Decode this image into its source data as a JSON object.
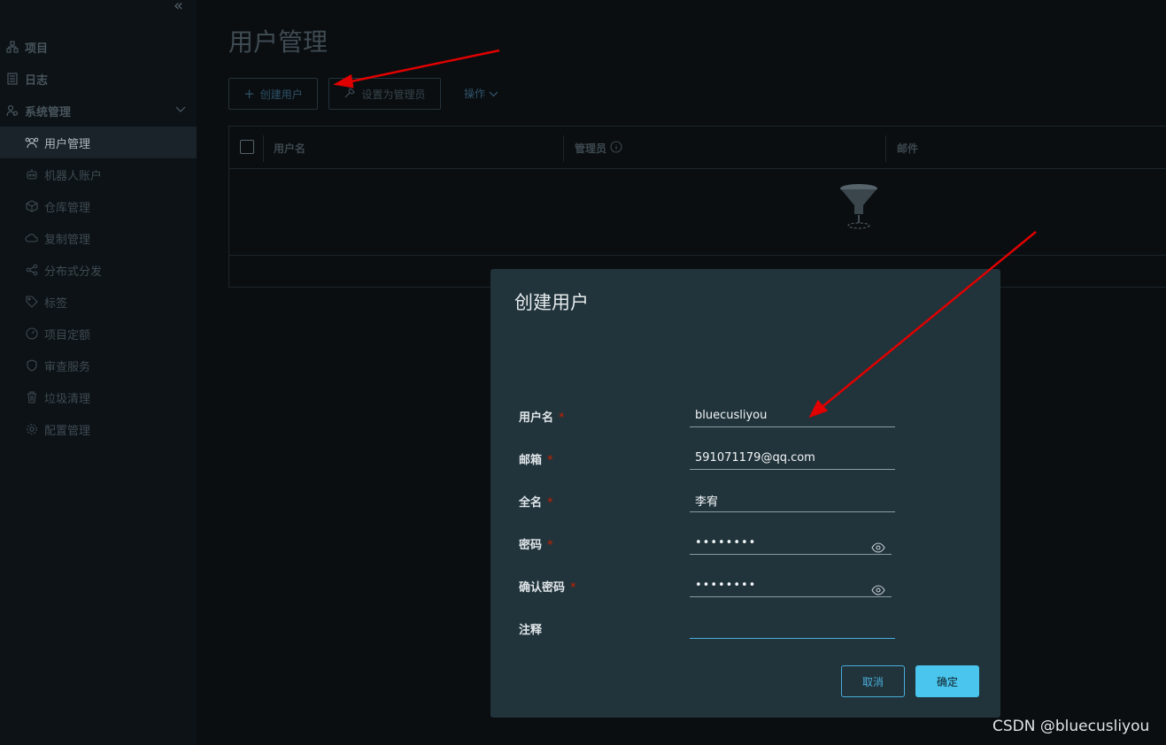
{
  "sidebar": {
    "collapse_glyph": "«",
    "items": [
      {
        "label": "项目",
        "icon": "project-icon"
      },
      {
        "label": "日志",
        "icon": "log-icon"
      },
      {
        "label": "系统管理",
        "icon": "system-admin-icon"
      },
      {
        "label": "用户管理",
        "icon": "users-icon"
      },
      {
        "label": "机器人账户",
        "icon": "robot-icon"
      },
      {
        "label": "仓库管理",
        "icon": "cube-icon"
      },
      {
        "label": "复制管理",
        "icon": "cloud-icon"
      },
      {
        "label": "分布式分发",
        "icon": "share-icon"
      },
      {
        "label": "标签",
        "icon": "tag-icon"
      },
      {
        "label": "项目定额",
        "icon": "dashboard-icon"
      },
      {
        "label": "审查服务",
        "icon": "shield-icon"
      },
      {
        "label": "垃圾清理",
        "icon": "trash-icon"
      },
      {
        "label": "配置管理",
        "icon": "gear-icon"
      }
    ]
  },
  "main": {
    "title": "用户管理",
    "toolbar": {
      "create_user": "创建用户",
      "set_admin": "设置为管理员",
      "actions": "操作"
    },
    "table": {
      "columns": [
        "用户名",
        "管理员",
        "邮件"
      ]
    }
  },
  "dialog": {
    "title": "创建用户",
    "fields": [
      {
        "label": "用户名",
        "value": "bluecusliyou",
        "required": "*"
      },
      {
        "label": "邮箱",
        "value": "591071179@qq.com",
        "required": "*"
      },
      {
        "label": "全名",
        "value": "李宥",
        "required": "*"
      },
      {
        "label": "密码",
        "value": "••••••••",
        "required": "*"
      },
      {
        "label": "确认密码",
        "value": "••••••••",
        "required": "*"
      },
      {
        "label": "注释",
        "value": ""
      }
    ],
    "cancel": "取消",
    "confirm": "确定"
  },
  "watermark": "CSDN @bluecusliyou",
  "colors": {
    "accent": "#49afd9",
    "dialog_bg": "#21333b",
    "annotation_arrow": "#e00000"
  }
}
